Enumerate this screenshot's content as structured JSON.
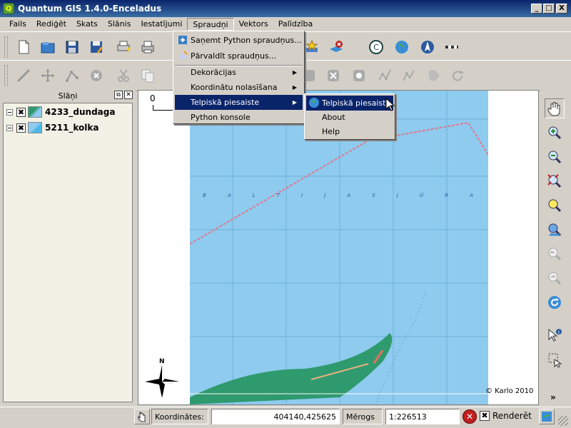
{
  "window": {
    "title": "Quantum GIS 1.4.0-Enceladus",
    "min": "_",
    "max": "□",
    "close": "X"
  },
  "menubar": [
    "Fails",
    "Rediģēt",
    "Skats",
    "Slānis",
    "Iestatījumi",
    "Spraudņi",
    "Vektors",
    "Palīdzība"
  ],
  "plugins_menu": {
    "items": [
      "Saņemt Python spraudņus...",
      "Pārvaldīt spraudņus...",
      "Dekorācijas",
      "Koordinātu nolasīšana",
      "Telpiskā piesaiste",
      "Python konsole"
    ]
  },
  "submenu": {
    "items": [
      "Telpiskā piesaiste",
      "About",
      "Help"
    ]
  },
  "layers_panel": {
    "title": "Slāņi",
    "layers": [
      {
        "name": "4233_dundaga",
        "checked": "✖",
        "expand": "−"
      },
      {
        "name": "5211_kolka",
        "checked": "✖",
        "expand": "−"
      }
    ]
  },
  "map": {
    "scale_zero": "0",
    "sea_label": [
      "B",
      "A",
      "L",
      "T",
      "I",
      "J",
      "A",
      "S",
      "J",
      "Ū",
      "R",
      "A"
    ],
    "copyright": "© Karlo 2010",
    "north_label": "N",
    "colors": {
      "sea": "#8ecbee",
      "land": "#2f9a6e",
      "border": "#e07890"
    }
  },
  "statusbar": {
    "coord_label": "Koordinātes:",
    "coord_value": "404140,425625",
    "scale_label": "Mērogs",
    "scale_value": "1:226513",
    "render_label": "Renderēt",
    "render_checked": "✖"
  },
  "rightbar_more": "»"
}
